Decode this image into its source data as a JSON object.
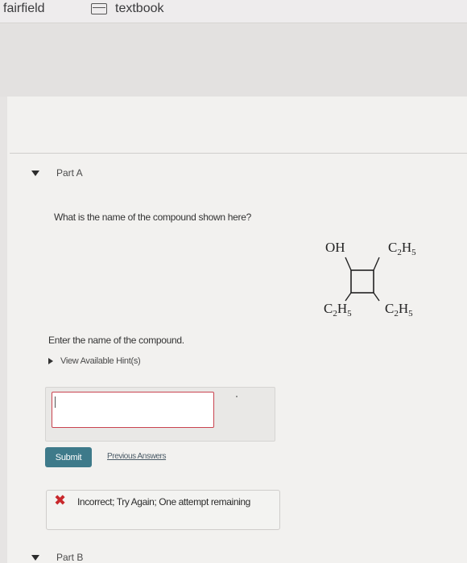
{
  "bookmarks": [
    {
      "label": "fairfield",
      "icon": "folder-icon"
    },
    {
      "label": "textbook",
      "icon": "folder-icon"
    }
  ],
  "part_a": {
    "label": "Part A",
    "question": "What is the name of the compound shown here?",
    "structure": {
      "top_left": "OH",
      "top_right": {
        "base": "C",
        "sub1": "2",
        "mid": "H",
        "sub2": "5"
      },
      "bottom_left": {
        "base": "C",
        "sub1": "2",
        "mid": "H",
        "sub2": "5"
      },
      "bottom_right": {
        "base": "C",
        "sub1": "2",
        "mid": "H",
        "sub2": "5"
      }
    },
    "instruction": "Enter the name of the compound.",
    "hint_link": "View Available Hint(s)",
    "input": {
      "value": "",
      "placeholder": ""
    },
    "submit_label": "Submit",
    "previous_answers_label": "Previous Answers",
    "feedback": "Incorrect; Try Again; One attempt remaining"
  },
  "part_b": {
    "label": "Part B"
  },
  "colors": {
    "submit": "#3e7a8a",
    "error": "#c8282c",
    "input_border": "#c9434f"
  }
}
